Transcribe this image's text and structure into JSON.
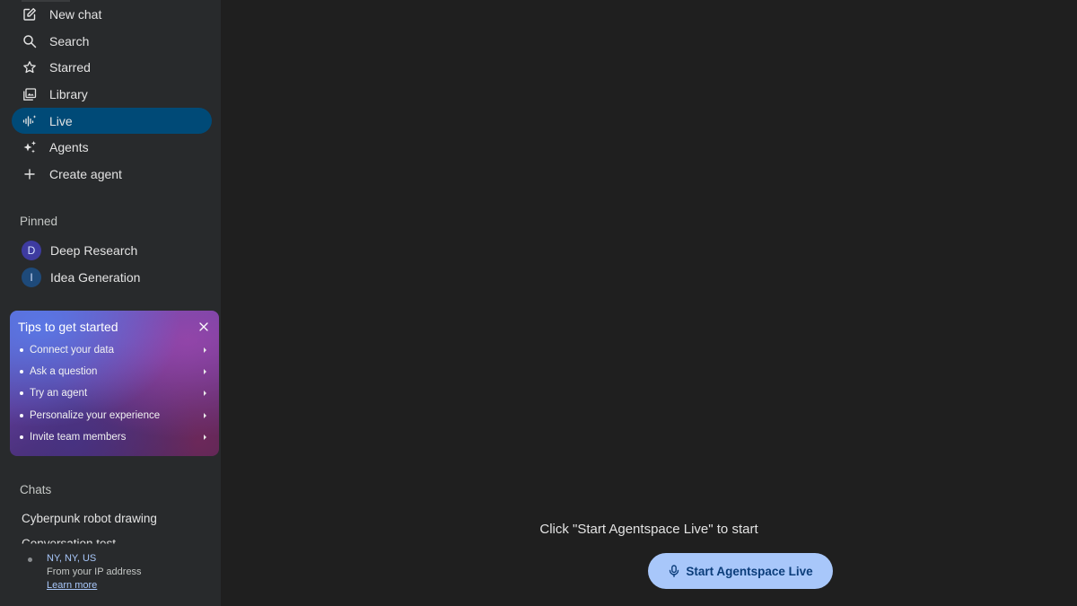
{
  "sidebar": {
    "nav": [
      {
        "label": "New chat",
        "icon": "new-chat-icon"
      },
      {
        "label": "Search",
        "icon": "search-icon"
      },
      {
        "label": "Starred",
        "icon": "star-icon"
      },
      {
        "label": "Library",
        "icon": "library-icon"
      },
      {
        "label": "Live",
        "icon": "live-waveform-icon",
        "active": true
      },
      {
        "label": "Agents",
        "icon": "sparkle-icon"
      },
      {
        "label": "Create agent",
        "icon": "plus-icon"
      }
    ],
    "pinned_title": "Pinned",
    "pinned": [
      {
        "initial": "D",
        "label": "Deep Research",
        "color": "#3e3ba0"
      },
      {
        "initial": "I",
        "label": "Idea Generation",
        "color": "#1e4a7a"
      }
    ],
    "tips": {
      "title": "Tips to get started",
      "items": [
        {
          "label": "Connect your data"
        },
        {
          "label": "Ask a question"
        },
        {
          "label": "Try an agent"
        },
        {
          "label": "Personalize your experience"
        },
        {
          "label": "Invite team members"
        }
      ]
    },
    "chats_title": "Chats",
    "chats": [
      {
        "label": "Cyberpunk robot drawing"
      },
      {
        "label": "Conversation test"
      }
    ],
    "location": {
      "city": "NY, NY, US",
      "source": "From your IP address",
      "link": "Learn more"
    }
  },
  "main": {
    "prompt": "Click \"Start Agentspace Live\" to start",
    "start_button": "Start Agentspace Live"
  },
  "colors": {
    "sidebar_bg": "#282a2c",
    "main_bg": "#1f1f1f",
    "active_item": "#004a77",
    "accent_button": "#a8c7fa",
    "link": "#a8c7fa"
  }
}
